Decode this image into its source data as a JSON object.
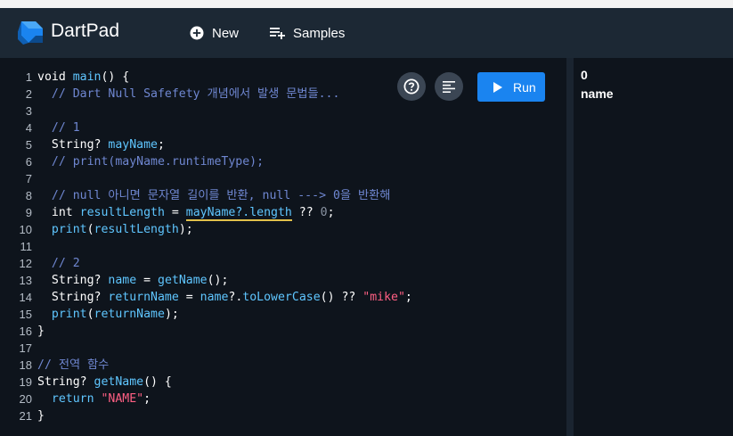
{
  "app": {
    "title": "DartPad"
  },
  "header": {
    "new_label": "New",
    "samples_label": "Samples"
  },
  "editor": {
    "run_label": "Run",
    "lines": [
      {
        "n": "1",
        "segs": [
          [
            "kw",
            "void "
          ],
          [
            "fn",
            "main"
          ],
          [
            "pl",
            "() {"
          ]
        ]
      },
      {
        "n": "2",
        "segs": [
          [
            "cm",
            "  // Dart Null Safefety 개념에서 발생 문법들..."
          ]
        ]
      },
      {
        "n": "3",
        "segs": []
      },
      {
        "n": "4",
        "segs": [
          [
            "cm",
            "  // 1"
          ]
        ]
      },
      {
        "n": "5",
        "segs": [
          [
            "kw",
            "  String? "
          ],
          [
            "fn",
            "mayName"
          ],
          [
            "pl",
            ";"
          ]
        ]
      },
      {
        "n": "6",
        "segs": [
          [
            "cm",
            "  // print(mayName.runtimeType);"
          ]
        ]
      },
      {
        "n": "7",
        "segs": []
      },
      {
        "n": "8",
        "segs": [
          [
            "cm",
            "  // null 아니면 문자열 길이를 반환, null ---> 0을 반환해"
          ]
        ]
      },
      {
        "n": "9",
        "segs": [
          [
            "kw",
            "  int "
          ],
          [
            "fn",
            "resultLength"
          ],
          [
            "pl",
            " = "
          ],
          [
            "fnsq",
            "mayName?.length"
          ],
          [
            "pl",
            " ?? "
          ],
          [
            "nm",
            "0"
          ],
          [
            "pl",
            ";"
          ]
        ]
      },
      {
        "n": "10",
        "segs": [
          [
            "fn",
            "  print"
          ],
          [
            "pl",
            "("
          ],
          [
            "fn",
            "resultLength"
          ],
          [
            "pl",
            ");"
          ]
        ]
      },
      {
        "n": "11",
        "segs": []
      },
      {
        "n": "12",
        "segs": [
          [
            "cm",
            "  // 2"
          ]
        ]
      },
      {
        "n": "13",
        "segs": [
          [
            "kw",
            "  String? "
          ],
          [
            "fn",
            "name"
          ],
          [
            "pl",
            " = "
          ],
          [
            "fn",
            "getName"
          ],
          [
            "pl",
            "();"
          ]
        ]
      },
      {
        "n": "14",
        "segs": [
          [
            "kw",
            "  String? "
          ],
          [
            "fn",
            "returnName"
          ],
          [
            "pl",
            " = "
          ],
          [
            "fn",
            "name"
          ],
          [
            "pl",
            "?."
          ],
          [
            "fn",
            "toLowerCase"
          ],
          [
            "pl",
            "() ?? "
          ],
          [
            "st",
            "\"mike\""
          ],
          [
            "pl",
            ";"
          ]
        ]
      },
      {
        "n": "15",
        "segs": [
          [
            "fn",
            "  print"
          ],
          [
            "pl",
            "("
          ],
          [
            "fn",
            "returnName"
          ],
          [
            "pl",
            ");"
          ]
        ]
      },
      {
        "n": "16",
        "segs": [
          [
            "pl",
            "}"
          ]
        ]
      },
      {
        "n": "17",
        "segs": []
      },
      {
        "n": "18",
        "segs": [
          [
            "cm",
            "// 전역 함수"
          ]
        ]
      },
      {
        "n": "19",
        "segs": [
          [
            "kw",
            "String? "
          ],
          [
            "fn",
            "getName"
          ],
          [
            "pl",
            "() {"
          ]
        ]
      },
      {
        "n": "20",
        "segs": [
          [
            "fn",
            "  return "
          ],
          [
            "st",
            "\"NAME\""
          ],
          [
            "pl",
            ";"
          ]
        ]
      },
      {
        "n": "21",
        "segs": [
          [
            "pl",
            "}"
          ]
        ]
      }
    ]
  },
  "output": {
    "lines": [
      "0",
      "name"
    ]
  },
  "colors": {
    "run_button": "#1a84f0",
    "header": "#1c2834",
    "background": "#0e141c"
  },
  "icons": {
    "logo": "dart-logo-icon",
    "new": "add-circle-icon",
    "samples": "playlist-add-icon",
    "help": "help-circle-icon",
    "format": "format-align-icon",
    "run": "play-icon"
  }
}
